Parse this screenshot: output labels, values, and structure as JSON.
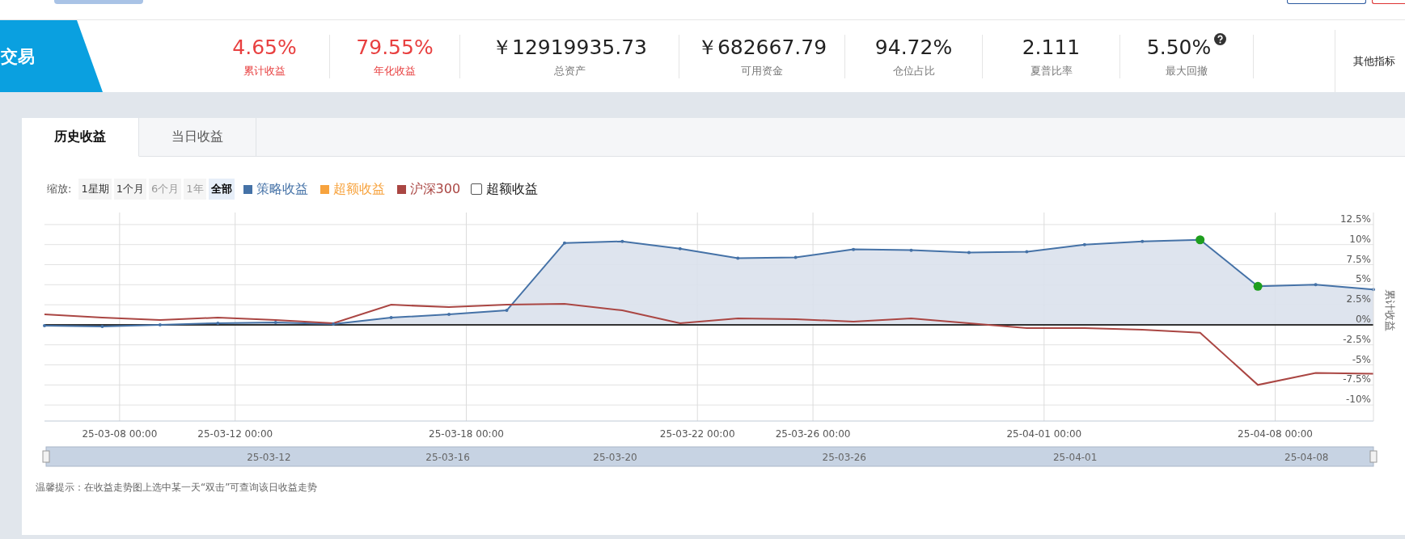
{
  "header": {
    "title": "交易",
    "stats": [
      {
        "value": "4.65%",
        "label": "累计收益",
        "color": "#e84040"
      },
      {
        "value": "79.55%",
        "label": "年化收益",
        "color": "#e84040"
      },
      {
        "value": "￥12919935.73",
        "label": "总资产",
        "color": "#222222"
      },
      {
        "value": "￥682667.79",
        "label": "可用资金",
        "color": "#222222"
      },
      {
        "value": "94.72%",
        "label": "仓位占比",
        "color": "#222222"
      },
      {
        "value": "2.111",
        "label": "夏普比率",
        "color": "#222222"
      },
      {
        "value": "5.50%",
        "label": "最大回撤",
        "color": "#222222",
        "help": true
      }
    ],
    "more": "其他指标"
  },
  "tabs": [
    {
      "label": "历史收益",
      "selected": true
    },
    {
      "label": "当日收益",
      "selected": false
    }
  ],
  "zoom": {
    "label": "缩放:",
    "options": [
      {
        "label": "1星期",
        "disabled": false,
        "selected": false
      },
      {
        "label": "1个月",
        "disabled": false,
        "selected": false
      },
      {
        "label": "6个月",
        "disabled": true,
        "selected": false
      },
      {
        "label": "1年",
        "disabled": true,
        "selected": false
      },
      {
        "label": "全部",
        "disabled": false,
        "selected": true
      }
    ]
  },
  "excess_toggle": {
    "label": "超额收益",
    "checked": false
  },
  "chart": {
    "chart_data": {
      "type": "line",
      "ylabel": "累计收益",
      "categories": [
        null,
        "25-03-08 00:00",
        null,
        "25-03-12 00:00",
        null,
        null,
        null,
        "25-03-18 00:00",
        null,
        null,
        null,
        "25-03-22 00:00",
        null,
        "25-03-26 00:00",
        null,
        null,
        null,
        "25-04-01 00:00",
        null,
        null,
        null,
        "25-04-08 00:00",
        null,
        null
      ],
      "series": [
        {
          "name": "策略收益",
          "color": "#4572a7",
          "values": [
            -0.1,
            -0.2,
            0,
            0.2,
            0.3,
            0.1,
            0.9,
            1.3,
            1.8,
            10.2,
            10.4,
            9.5,
            8.3,
            8.4,
            9.4,
            9.3,
            9.0,
            9.1,
            10.0,
            10.4,
            10.6,
            4.8,
            5.0,
            4.4
          ]
        },
        {
          "name": "超额收益",
          "color": "#f7a33e",
          "values": [
            null,
            null,
            null,
            null,
            null,
            null,
            null,
            null,
            null,
            null,
            null,
            null,
            null,
            null,
            null,
            null,
            null,
            null,
            null,
            null,
            null,
            null,
            null,
            null
          ]
        },
        {
          "name": "沪深300",
          "color": "#aa4643",
          "values": [
            1.3,
            0.9,
            0.6,
            0.9,
            0.6,
            0.2,
            2.5,
            2.2,
            2.5,
            2.6,
            1.8,
            0.2,
            0.8,
            0.7,
            0.4,
            0.8,
            0.2,
            -0.4,
            -0.4,
            -0.6,
            -1.0,
            -7.5,
            -6.0,
            -6.1
          ]
        }
      ],
      "ylim": [
        -12,
        14
      ],
      "yticks": [
        {
          "value": 12.5,
          "label": "12.5%"
        },
        {
          "value": 10,
          "label": "10%"
        },
        {
          "value": 7.5,
          "label": "7.5%"
        },
        {
          "value": 5,
          "label": "5%"
        },
        {
          "value": 2.5,
          "label": "2.5%"
        },
        {
          "value": 0,
          "label": "0%"
        },
        {
          "value": -2.5,
          "label": "-2.5%"
        },
        {
          "value": -5,
          "label": "-5%"
        },
        {
          "value": -7.5,
          "label": "-7.5%"
        },
        {
          "value": -10,
          "label": "-10%"
        }
      ],
      "grid": true
    },
    "point_markers": [
      false,
      false,
      false,
      false,
      false,
      false,
      false,
      false,
      false,
      false,
      false,
      false,
      false,
      false,
      false,
      false,
      false,
      false,
      false,
      false,
      true,
      true,
      false,
      false
    ]
  },
  "navigator": {
    "labels": [
      "25-03-12",
      "25-03-16",
      "25-03-20",
      "25-03-26",
      "25-04-01",
      "25-04-08"
    ]
  },
  "hint": "温馨提示：在收益走势图上选中某一天“双击”可查询该日收益走势"
}
